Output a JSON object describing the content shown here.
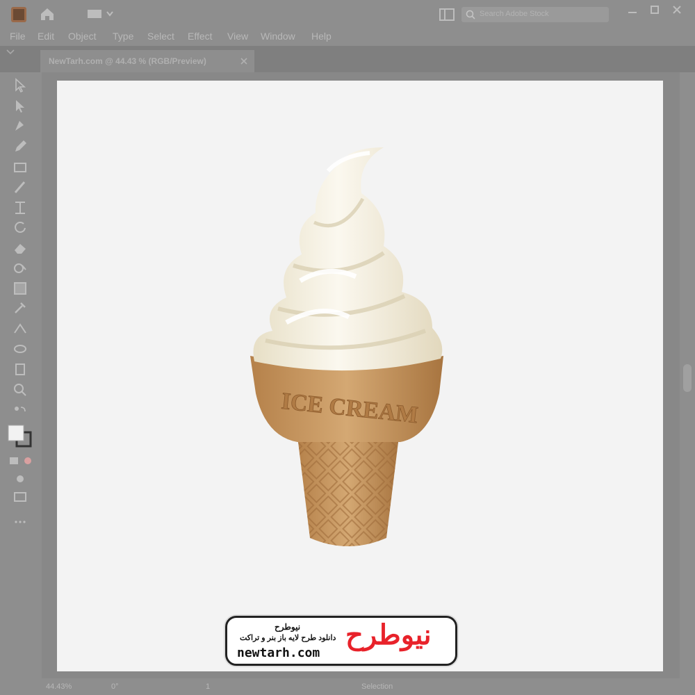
{
  "menu": [
    "File",
    "Edit",
    "Object",
    "Type",
    "Select",
    "Effect",
    "View",
    "Window",
    "Help"
  ],
  "document_tab": "NewTarh.com @ 44.43 % (RGB/Preview)",
  "search": {
    "placeholder": "Search Adobe Stock"
  },
  "cone_text": "ICE CREAM",
  "status": {
    "zoom": "44.43%",
    "rotation": "0°",
    "artboard": "1",
    "tool": "Selection"
  },
  "watermark": {
    "brand_fa": "نیوطرح",
    "tagline_fa": "دانلود طرح لایه باز بنر و تراکت",
    "url": "newtarh.com",
    "logo_word": "نیوطرح"
  },
  "colors": {
    "ui_gray": "#8e8e8e",
    "artboard": "#f3f3f3",
    "cone": "#c89a62",
    "cream": "#f5f0df",
    "logo_red": "#e8222a",
    "logo_blue": "#1f5fd0"
  }
}
